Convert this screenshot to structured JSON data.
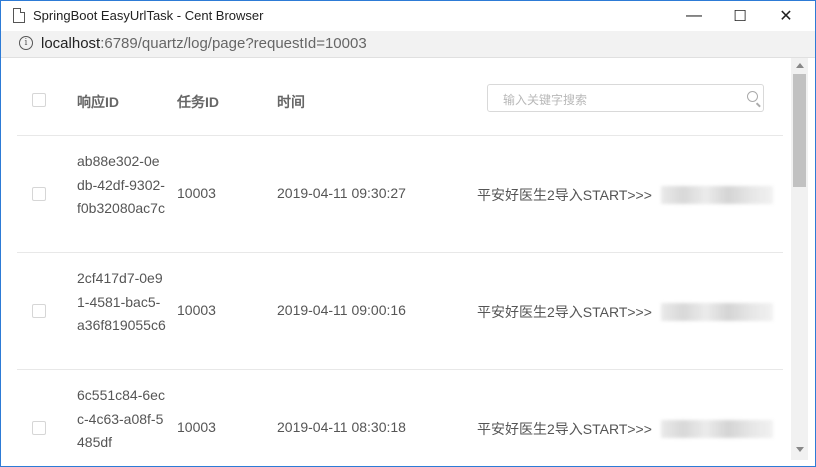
{
  "window": {
    "title": "SpringBoot EasyUrlTask - Cent Browser",
    "minimize": "—",
    "maximize": "☐",
    "close": "✕"
  },
  "address": {
    "host": "localhost",
    "path": ":6789/quartz/log/page?requestId=10003"
  },
  "table": {
    "headers": {
      "id": "响应ID",
      "task": "任务ID",
      "time": "时间"
    },
    "search_placeholder": "输入关键字搜索",
    "rows": [
      {
        "id": "ab88e302-0edb-42df-9302-f0b32080ac7c",
        "task": "10003",
        "time": "2019-04-11 09:30:27",
        "msg": "平安好医生2导入START>>>"
      },
      {
        "id": "2cf417d7-0e91-4581-bac5-a36f819055c6",
        "task": "10003",
        "time": "2019-04-11 09:00:16",
        "msg": "平安好医生2导入START>>>"
      },
      {
        "id": "6c551c84-6ecc-4c63-a08f-5485df",
        "task": "10003",
        "time": "2019-04-11 08:30:18",
        "msg": "平安好医生2导入START>>>"
      }
    ]
  },
  "colors": {
    "frame": "#2d7bd6",
    "header_text": "#666666",
    "scroll_thumb": "#c1c1c1"
  }
}
